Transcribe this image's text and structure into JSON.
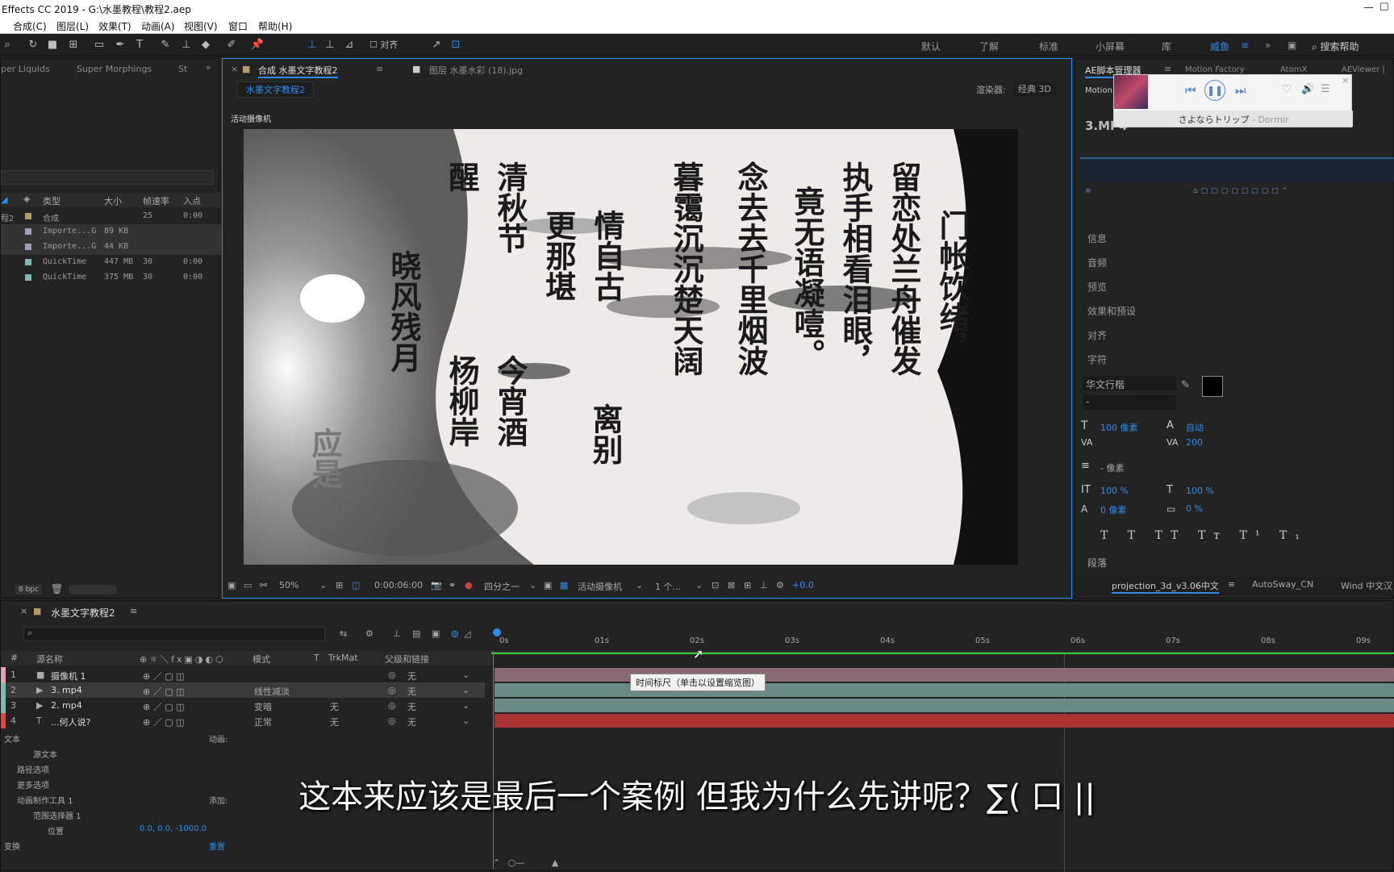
{
  "titlebar": {
    "title": "Effects CC 2019 - G:\\水墨教程\\教程2.aep"
  },
  "menu": [
    "合成(C)",
    "图层(L)",
    "效果(T)",
    "动画(A)",
    "视图(V)",
    "窗口",
    "帮助(H)"
  ],
  "toolbar": {
    "align_label": "对齐"
  },
  "workspaces": [
    "默认",
    "了解",
    "标准",
    "小屏幕",
    "库",
    "威鱼"
  ],
  "search_help": "搜索帮助",
  "left_panel": {
    "tabs": [
      "per Liquids",
      "Super Morphings",
      "St"
    ],
    "columns": [
      "类型",
      "大小",
      "帧速率",
      "入点"
    ],
    "rows": [
      {
        "name": "程2",
        "type": "合成",
        "size": "",
        "fps": "25",
        "in": "0:00",
        "color": "#b59a6a"
      },
      {
        "name": "",
        "type": "Importe...G",
        "size": "89 KB",
        "fps": "",
        "in": "",
        "color": "#a59ab8"
      },
      {
        "name": "",
        "type": "Importe...G",
        "size": "44 KB",
        "fps": "",
        "in": "",
        "color": "#a59ab8"
      },
      {
        "name": "",
        "type": "QuickTime",
        "size": "447 MB",
        "fps": "30",
        "in": "0:00",
        "color": "#7fb9b0"
      },
      {
        "name": "",
        "type": "QuickTime",
        "size": "375 MB",
        "fps": "30",
        "in": "0:00",
        "color": "#7fb9b0"
      }
    ],
    "bpc": "8 bpc"
  },
  "comp_panel": {
    "tab_comp": "合成 水墨文字教程2",
    "tab_layer": "图层 水墨水彩 (18).jpg",
    "sub_tab": "水墨文字教程2",
    "renderer_label": "渲染器:",
    "renderer_value": "经典 3D",
    "active_camera": "活动摄像机",
    "zoom": "50%",
    "timecode": "0:00:06:00",
    "resolution": "四分之一",
    "view": "活动摄像机",
    "views_count": "1 个...",
    "exposure": "+0.0"
  },
  "poem_columns": [
    "醒",
    "清秋节",
    "更那堪",
    "情自古",
    "暮霭沉沉楚天阔",
    "念去去千里烟波",
    "竟无语凝噎。",
    "执手相看泪眼，",
    "留恋处兰舟催发",
    "门帐饮绪，",
    "晓风残月",
    "杨柳岸",
    "今宵酒",
    "离别",
    "应是"
  ],
  "poem_text_top": [
    "醒",
    "清",
    "",
    "",
    "暮",
    "念",
    "",
    "执",
    "留"
  ],
  "right_panel": {
    "tabs": [
      "AE脚本管理器",
      "Motion Factory",
      "AtomX",
      "AEViewer | D"
    ],
    "file": "3.MP4",
    "sections": [
      "信息",
      "音频",
      "预览",
      "效果和预设",
      "对齐",
      "字符"
    ],
    "font_name": "华文行楷",
    "font_size": "100 像素",
    "leading": "自动",
    "tracking": "200",
    "stroke": "- 像素",
    "vscale": "100 %",
    "hscale": "100 %",
    "baseline": "0 像素",
    "tsume": "0 %",
    "paragraph": "段落",
    "bottom_tabs": [
      "projection_3d_v3.06中文",
      "AutoSway_CN",
      "Wind 中文汉"
    ]
  },
  "music_widget": {
    "song": "さよならトリップ",
    "artist": " - Dormir"
  },
  "timeline": {
    "tab": "水墨文字教程2",
    "columns": [
      "#",
      "源名称",
      "模式",
      "T",
      "TrkMat",
      "父级和链接"
    ],
    "layers": [
      {
        "num": "1",
        "name": "摄像机 1",
        "mode": "",
        "trk": "",
        "parent": "无",
        "color": "#e7a0b0"
      },
      {
        "num": "2",
        "name": "3. mp4",
        "mode": "线性减淡",
        "trk": "",
        "parent": "无",
        "color": "#7fb9b0"
      },
      {
        "num": "3",
        "name": "2. mp4",
        "mode": "变暗",
        "trk": "无",
        "parent": "无",
        "color": "#7fb9b0"
      },
      {
        "num": "4",
        "name": "...何人说?",
        "mode": "正常",
        "trk": "无",
        "parent": "无",
        "color": "#d44"
      }
    ],
    "props": [
      {
        "label": "文本",
        "extra": "动画:"
      },
      {
        "label": "源文本",
        "extra": ""
      },
      {
        "label": "路径选项",
        "extra": ""
      },
      {
        "label": "更多选项",
        "extra": ""
      },
      {
        "label": "动画制作工具 1",
        "extra": "添加:"
      },
      {
        "label": "范围选择器 1",
        "extra": ""
      },
      {
        "label": "位置",
        "extra": "0.0, 0.0, -1000.0"
      },
      {
        "label": "变换",
        "extra": "重置"
      }
    ],
    "ruler": [
      "0s",
      "01s",
      "02s",
      "03s",
      "04s",
      "05s",
      "06s",
      "07s",
      "08s",
      "09s"
    ],
    "tooltip": "时间标尺（单击以设置缩览图）"
  },
  "subtitle": "这本来应该是最后一个案例 但我为什么先讲呢？∑( 口 ||"
}
